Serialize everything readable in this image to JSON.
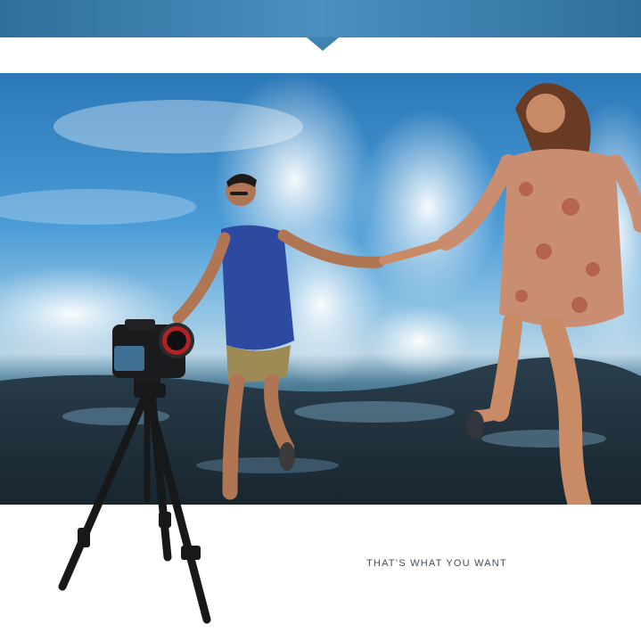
{
  "banner": {
    "color": "#3d82b3",
    "notch_icon": "chevron-down-icon"
  },
  "photo": {
    "subject_icon": "photo-couple-running-with-camera-tripod"
  },
  "tagline": "THAT’S WHAT YOU WANT"
}
